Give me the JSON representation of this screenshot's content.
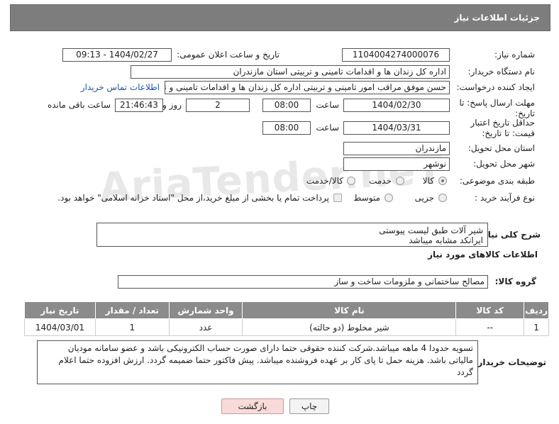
{
  "header": {
    "title": "جزئیات اطلاعات نیاز"
  },
  "watermark": {
    "text": "AriaTender.neT"
  },
  "form": {
    "need_number": {
      "label": "شماره نیاز:",
      "value": "1104004274000076"
    },
    "announce_datetime": {
      "label": "تاریخ و ساعت اعلان عمومی:",
      "value": "1404/02/27 - 09:13"
    },
    "buyer_org": {
      "label": "نام دستگاه خریدار:",
      "value": "اداره کل زندان ها و اقدامات تامینی و تربیتی استان مازندران"
    },
    "requester": {
      "label": "ایجاد کننده درخواست:",
      "value": "حسن موفق مراقب امور تامینی و تربیتی اداره کل زندان ها و اقدامات تامینی و تربیتی",
      "contact_link": "اطلاعات تماس خریدار"
    },
    "send_deadline": {
      "label": "مهلت ارسال پاسخ: تا تاریخ:",
      "date": "1404/02/30",
      "time_label": "ساعت",
      "time": "08:00",
      "days": "2",
      "days_label": "روز و",
      "remaining_time": "21:46:43",
      "remaining_label": "ساعت باقی مانده"
    },
    "price_validity": {
      "label": "حداقل تاریخ اعتبار قیمت: تا تاریخ:",
      "date": "1404/03/31",
      "time_label": "ساعت",
      "time": "08:00"
    },
    "province": {
      "label": "استان محل تحویل:",
      "value": "مازندران"
    },
    "city": {
      "label": "شهر محل تحویل:",
      "value": "نوشهر"
    },
    "category": {
      "label": "طبقه بندی موضوعی:",
      "options": [
        "کالا",
        "خدمت",
        "کالا/خدمت"
      ]
    },
    "process_type": {
      "label": "نوع فرآیند خرید :",
      "options": [
        "جزیی",
        "متوسط"
      ],
      "payment_note": "پرداخت تمام یا بخشی از مبلغ خرید،از محل \"اسناد خزانه اسلامی\" خواهد بود."
    }
  },
  "description": {
    "label": "شرح کلی نیاز:",
    "text": "شیر آلات طبق لیست پیوستی\nایرانکد مشابه میباشد"
  },
  "goods_section": {
    "title": "اطلاعات کالاهای مورد نیاز"
  },
  "goods_group": {
    "label": "گروه کالا:",
    "value": "مصالح ساختمانی و ملزومات ساخت و ساز"
  },
  "table": {
    "headers": [
      "ردیف",
      "کد کالا",
      "نام کالا",
      "واحد شمارش",
      "تعداد / مقدار",
      "تاریخ نیاز"
    ],
    "rows": [
      [
        "1",
        "--",
        "شیر مخلوط (دو حالته)",
        "عدد",
        "1",
        "1404/03/01"
      ]
    ]
  },
  "buyer_notes": {
    "label": "توضیحات خریدار:",
    "text": "تسویه حدودا 4 ماهه میباشد.شرکت کننده حقوقی حتما دارای صورت حساب الکترونیکی باشد و عضو سامانه مودیان مالیاتی باشد. هزینه حمل تا پای کار بر عهده فروشنده میباشد. پیش فاکتور حتما ضمیمه گردد. ارزش افزوده حتما اعلام گردد"
  },
  "buttons": {
    "back": "بازگشت",
    "print": "چاپ"
  },
  "colors": {
    "header_bg": "#7d7d7d",
    "link": "#1a54b6",
    "back_button_bg": "#f9dada"
  }
}
